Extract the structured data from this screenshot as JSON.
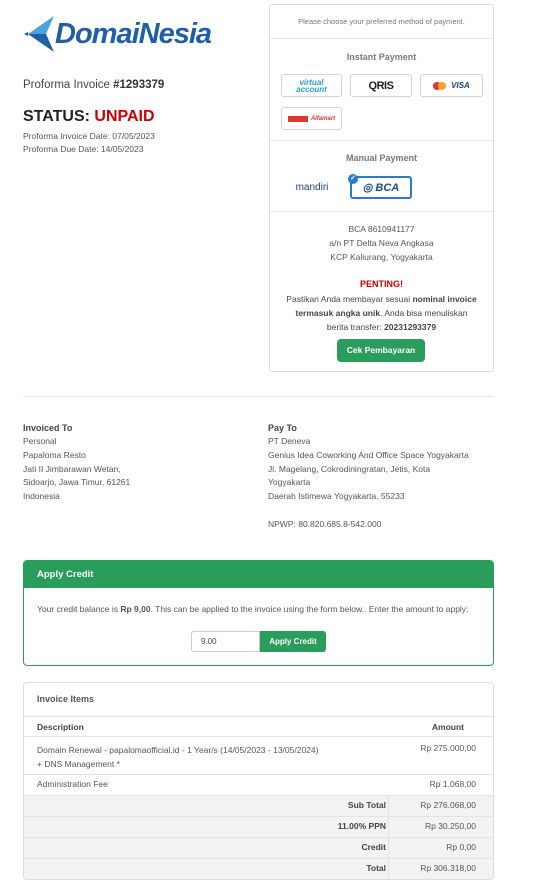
{
  "brand": {
    "logo_text": "DomaiNesia",
    "accent": "#1f5fa8"
  },
  "invoice": {
    "title_prefix": "Proforma Invoice ",
    "number": "#1293379",
    "status_label": "STATUS: ",
    "status_value": "UNPAID",
    "invoice_date": "Proforma Invoice Date: 07/05/2023",
    "due_date": "Proforma Due Date: 14/05/2023"
  },
  "payment": {
    "choose_text": "Please choose your preferred method of payment.",
    "instant_heading": "Instant Payment",
    "instant_methods": [
      "virtual account",
      "QRIS",
      "MasterCard VISA",
      "Alfamart"
    ],
    "manual_heading": "Manual Payment",
    "manual_methods": [
      "mandiri",
      "BCA"
    ],
    "selected_method": "BCA",
    "bank_account": "BCA 8610941177",
    "account_name": "a/n PT Delta Neva Angkasa",
    "branch": "KCP Kaliurang, Yogyakarta",
    "important_label": "PENTING!",
    "notice_part1": "Pastikan Anda membayar sesuai ",
    "notice_bold": "nominal invoice termasuk angka unik",
    "notice_part2": ". Anda bisa menuliskan berita transfer: ",
    "transfer_code": "20231293379",
    "check_button": "Cek Pembayaran"
  },
  "invoiced_to": {
    "heading": "Invoiced To",
    "lines": [
      "Personal",
      "Papaloma Resto",
      "Jati II Jimbarawan Wetan,",
      "Sidoarjo, Jawa Timur, 61261",
      "Indonesia"
    ]
  },
  "pay_to": {
    "heading": "Pay To",
    "lines": [
      "PT Deneva",
      "Genius Idea Coworking And Office Space Yogyakarta",
      "Jl. Magelang, Cokrodiningratan, Jetis, Kota",
      "Yogyakarta",
      "Daerah Istimewa Yogyakarta, 55233"
    ],
    "npwp": "NPWP: 80.820.685.8-542.000"
  },
  "credit": {
    "heading": "Apply Credit",
    "text_prefix": "Your credit balance is ",
    "balance": "Rp 9,00",
    "text_suffix": ". This can be applied to the invoice using the form below.. Enter the amount to apply:",
    "input_value": "9.00",
    "button": "Apply Credit"
  },
  "items": {
    "heading": "Invoice Items",
    "col_description": "Description",
    "col_amount": "Amount",
    "rows": [
      {
        "description": "Domain Renewal - papalomaofficial.id - 1 Year/s (14/05/2023 - 13/05/2024)",
        "description2": "+ DNS Management *",
        "amount": "Rp 275.000,00"
      },
      {
        "description": "Administration Fee",
        "amount": "Rp 1.068,00"
      }
    ],
    "subtotal_label": "Sub Total",
    "subtotal": "Rp 276.068,00",
    "tax_label": "11.00% PPN",
    "tax": "Rp 30.250,00",
    "credit_label": "Credit",
    "credit": "Rp 0,00",
    "total_label": "Total",
    "total": "Rp 306.318,00"
  }
}
